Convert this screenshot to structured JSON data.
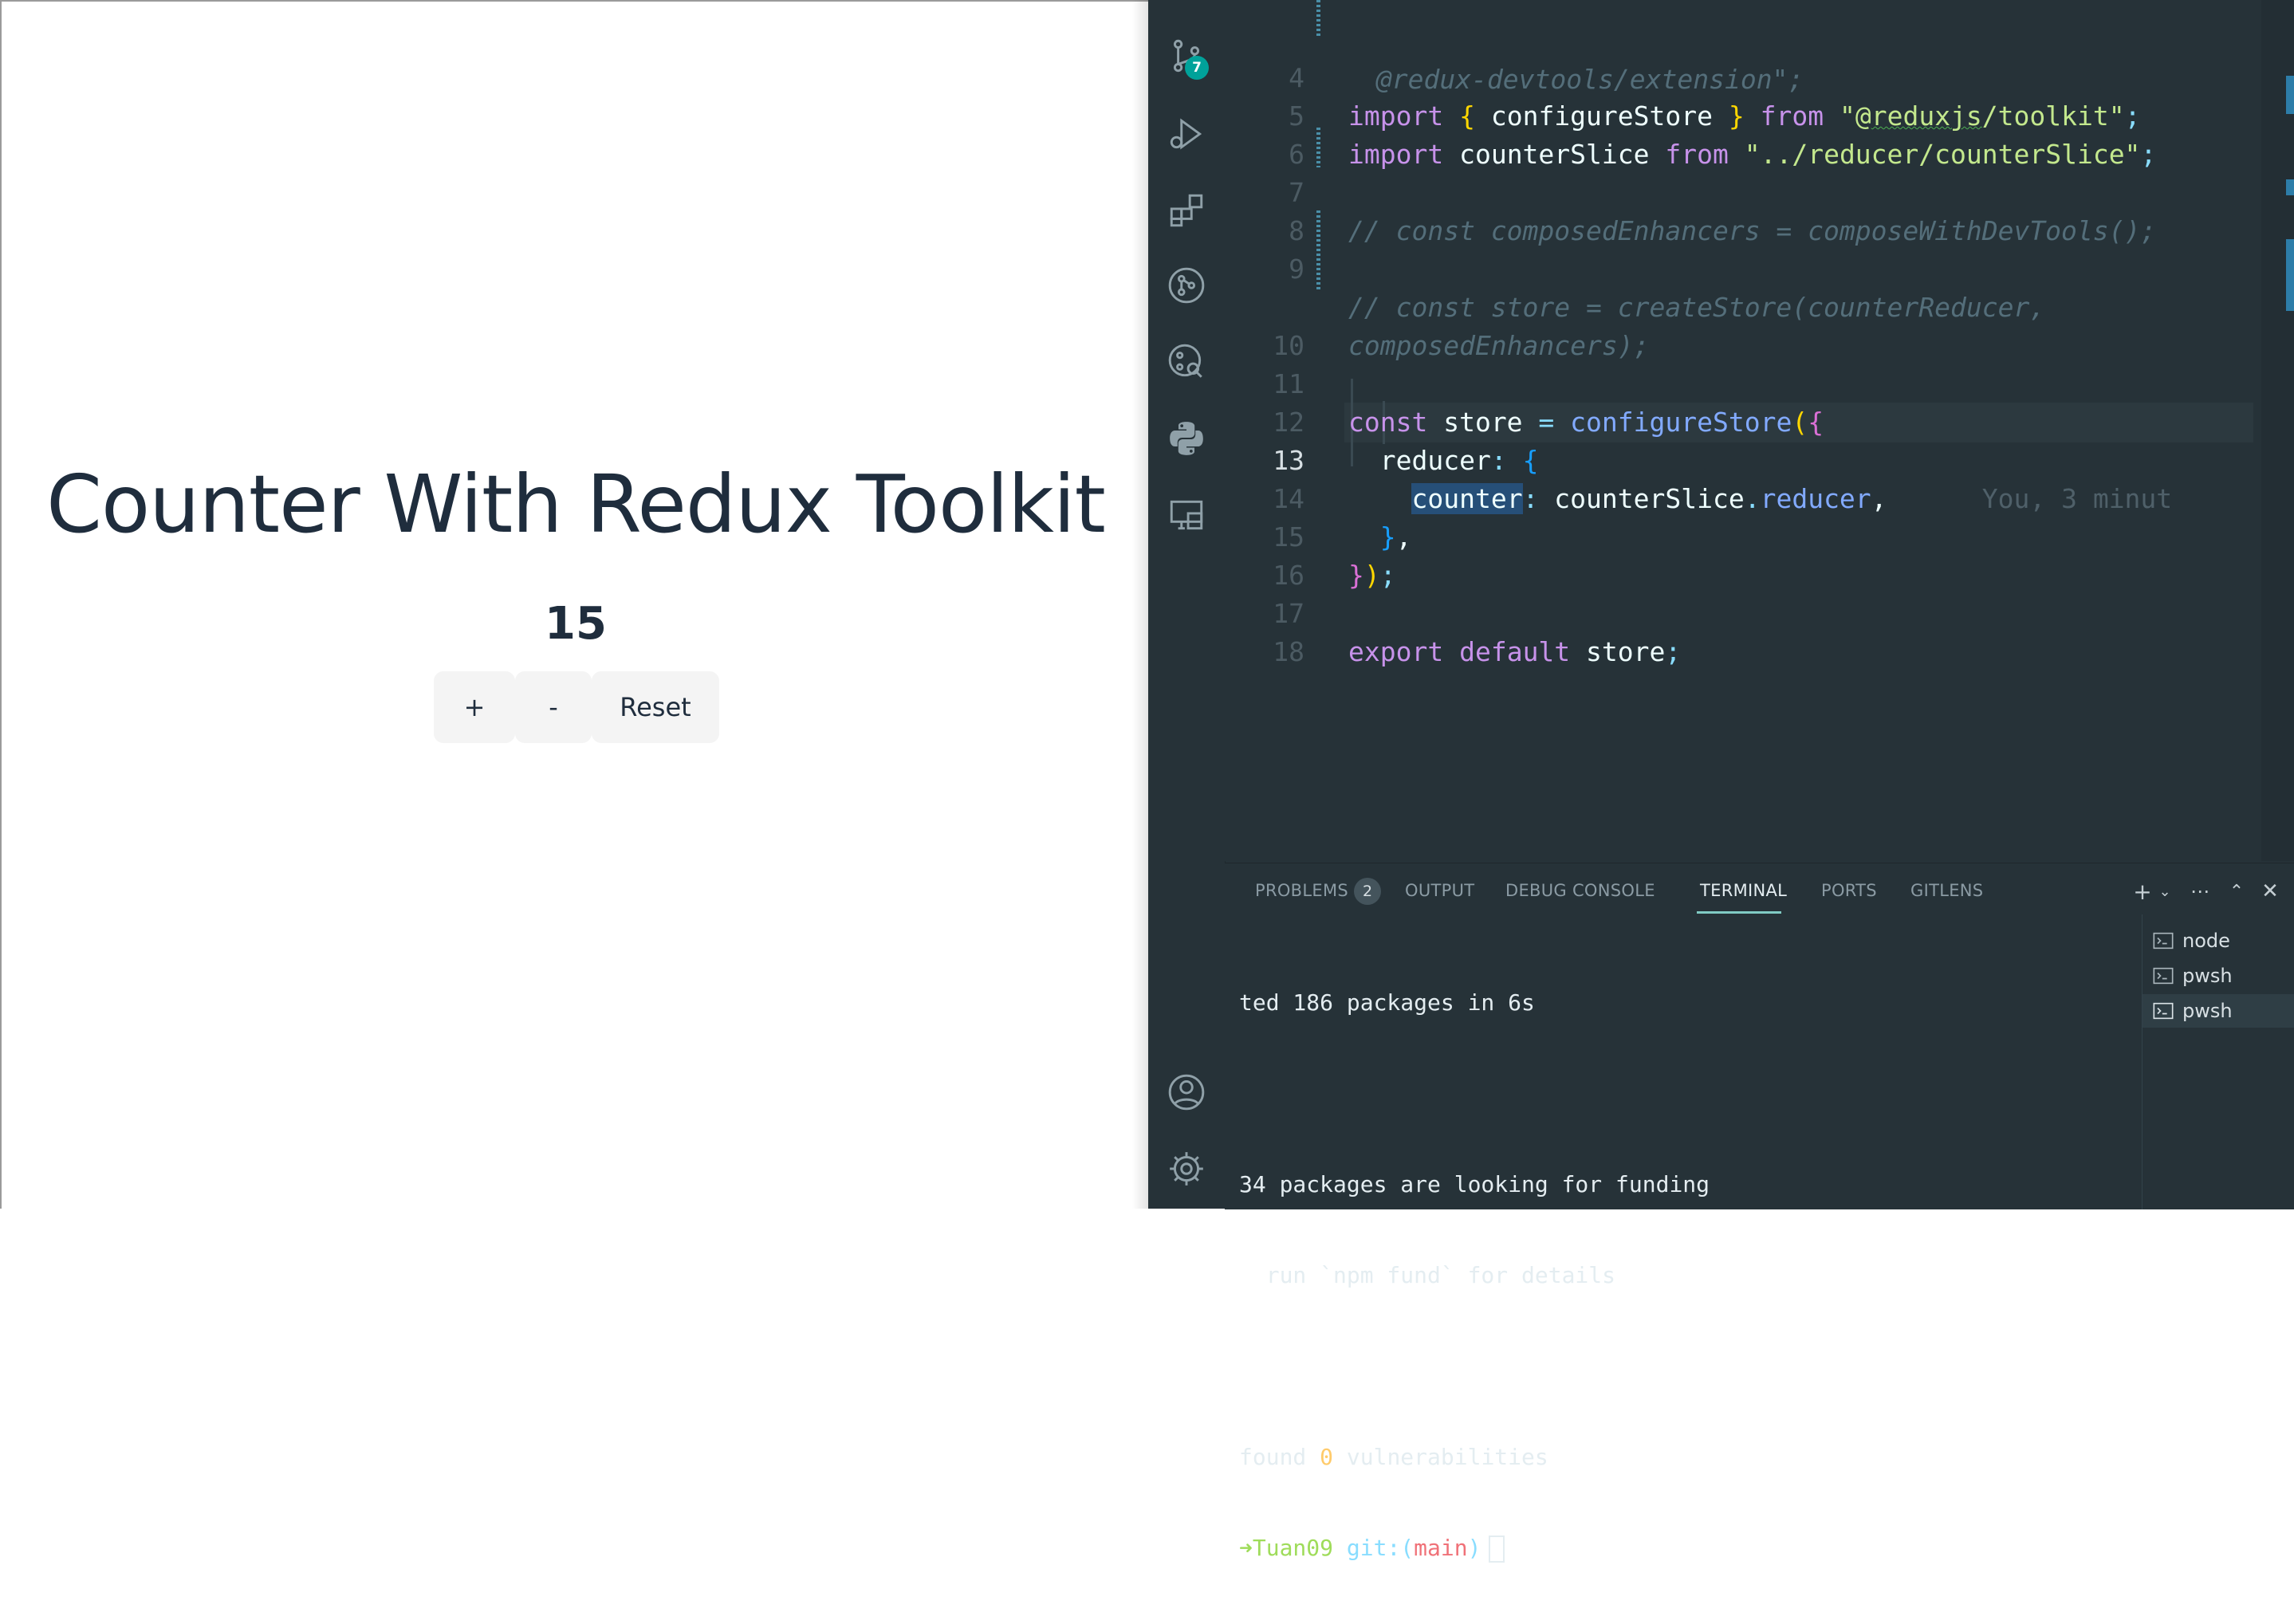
{
  "app": {
    "title": "Counter With Redux Toolkit",
    "count": "15",
    "buttons": {
      "increment": "+",
      "decrement": "-",
      "reset": "Reset"
    }
  },
  "activity_bar": {
    "items": [
      "source-control",
      "run-and-debug",
      "extensions",
      "git-graph",
      "gitlens",
      "python",
      "remote-explorer"
    ],
    "source_control_badge": "7",
    "bottom": [
      "accounts",
      "manage"
    ]
  },
  "editor": {
    "active_line": 13,
    "lines": [
      {
        "n": "",
        "t": " @redux-devtools/extension\";"
      },
      {
        "n": "4",
        "t": "import { configureStore } from \"@reduxjs/toolkit\";"
      },
      {
        "n": "5",
        "t": "import counterSlice from \"../reducer/counterSlice\";"
      },
      {
        "n": "6",
        "t": ""
      },
      {
        "n": "7",
        "t": "// const composedEnhancers = composeWithDevTools();"
      },
      {
        "n": "8",
        "t": ""
      },
      {
        "n": "9",
        "t": "// const store = createStore(counterReducer,"
      },
      {
        "n": "",
        "t": "composedEnhancers);"
      },
      {
        "n": "10",
        "t": ""
      },
      {
        "n": "11",
        "t": "const store = configureStore({"
      },
      {
        "n": "12",
        "t": "  reducer: {"
      },
      {
        "n": "13",
        "t": "    counter: counterSlice.reducer,"
      },
      {
        "n": "14",
        "t": "  },"
      },
      {
        "n": "15",
        "t": "});"
      },
      {
        "n": "16",
        "t": ""
      },
      {
        "n": "17",
        "t": "export default store;"
      },
      {
        "n": "18",
        "t": ""
      }
    ],
    "blame": "You, 3 minut"
  },
  "panel": {
    "tabs": [
      "PROBLEMS",
      "OUTPUT",
      "DEBUG CONSOLE",
      "TERMINAL",
      "PORTS",
      "GITLENS"
    ],
    "active_tab": "TERMINAL",
    "problems_count": "2",
    "terminal_lines": [
      "ted 186 packages in 6s",
      "",
      "34 packages are looking for funding",
      "  run `npm fund` for details",
      "",
      "found 0 vulnerabilities"
    ],
    "prompt": {
      "arrow": "➜",
      "user": "Tuan09",
      "git": "git:(",
      "branch": "main",
      "close": ")"
    },
    "terminals": [
      "node",
      "pwsh",
      "pwsh"
    ],
    "active_terminal": 2
  },
  "colors": {
    "editor_bg": "#263238",
    "accent": "#80cbc4",
    "badge": "#00a29a",
    "title_text": "#1f2d3d"
  }
}
